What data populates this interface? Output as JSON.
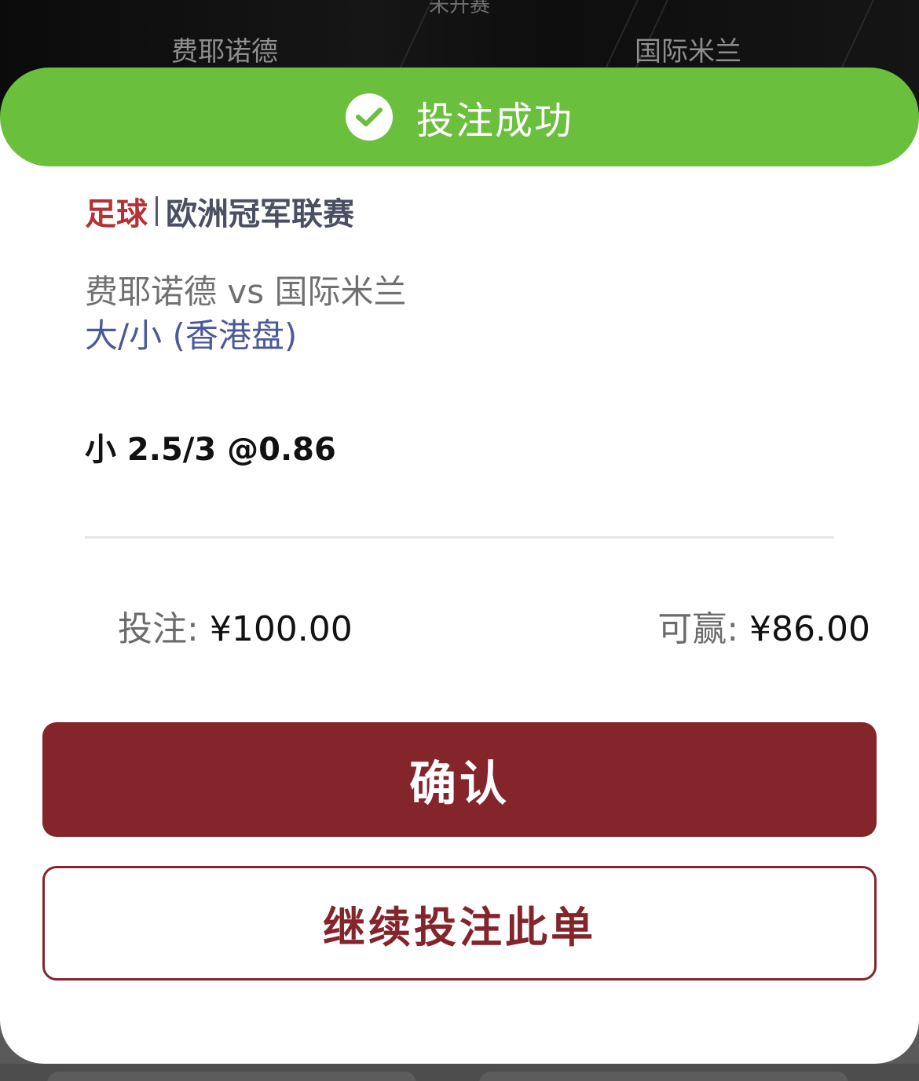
{
  "background_header": {
    "status": "未开赛",
    "home_team": "费耶诺德",
    "away_team": "国际米兰"
  },
  "banner": {
    "icon": "check-circle-icon",
    "text": "投注成功",
    "color": "#6abf3c"
  },
  "bet": {
    "sport": "足球",
    "league": "欧洲冠军联赛",
    "match": "费耶诺德 vs 国际米兰",
    "market": "大/小 (香港盘)",
    "selection": "小 2.5/3 @0.86"
  },
  "summary": {
    "stake_label": "投注:",
    "stake_value": "¥100.00",
    "win_label": "可赢:",
    "win_value": "¥86.00"
  },
  "actions": {
    "confirm_label": "确认",
    "continue_label": "继续投注此单"
  },
  "colors": {
    "accent": "#84252b",
    "sport": "#b43236",
    "market": "#4a5a99"
  }
}
